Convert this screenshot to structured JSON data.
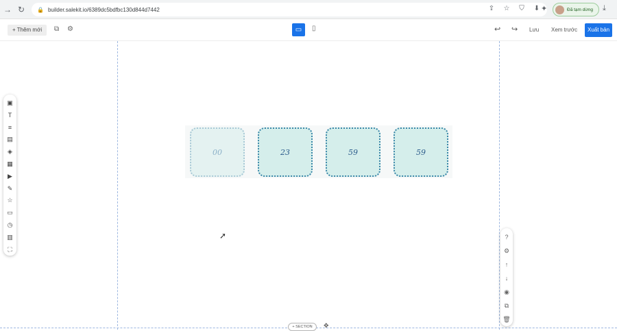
{
  "browser": {
    "url": "builder.salekit.io/6389dc5bdfbc130d844d7442",
    "profile_label": "Đã tạm dừng",
    "nav_icons": [
      "back-arrow-icon",
      "reload-icon"
    ],
    "omni_icons": [
      "share-icon",
      "star-icon",
      "shield-icon",
      "download-box-icon"
    ]
  },
  "toolbar": {
    "add_new_label": "+ Thêm mới",
    "save_label": "Lưu",
    "preview_label": "Xem trước",
    "publish_label": "Xuất bản"
  },
  "left_panel": {
    "icons": [
      "image-icon",
      "text-icon",
      "paragraph-icon",
      "form-icon",
      "shape-icon",
      "gallery-icon",
      "video-icon",
      "carousel-icon",
      "star-icon",
      "popup-icon",
      "timer-icon",
      "section-icon",
      "frame-icon"
    ]
  },
  "right_panel": {
    "icons": [
      "help-icon",
      "settings-icon",
      "move-up-icon",
      "move-down-icon",
      "hide-icon",
      "duplicate-icon",
      "delete-icon"
    ]
  },
  "countdown": {
    "values": [
      "00",
      "23",
      "59",
      "59"
    ]
  },
  "section": {
    "label": "+ SECTION"
  }
}
